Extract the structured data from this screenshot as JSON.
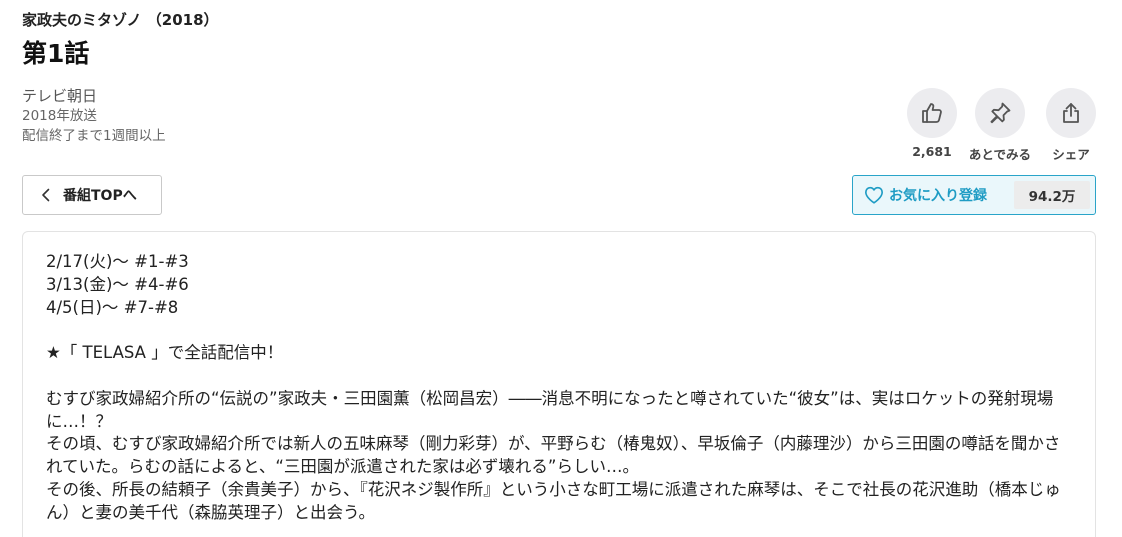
{
  "series_title": "家政夫のミタゾノ （2018）",
  "episode_title": "第1話",
  "meta": {
    "broadcaster": "テレビ朝日",
    "year": "2018年放送",
    "expiry": "配信終了まで1週間以上"
  },
  "actions": {
    "like": {
      "icon": "thumbs-up-icon",
      "label": "2,681"
    },
    "later": {
      "icon": "pin-icon",
      "label": "あとでみる"
    },
    "share": {
      "icon": "share-icon",
      "label": "シェア"
    }
  },
  "back_button": {
    "label": "番組TOPへ"
  },
  "favorite": {
    "label": "お気に入り登録",
    "count": "94.2万"
  },
  "colors": {
    "accent": "#1f9cc4",
    "accent_bg": "#eaf7fb",
    "circle_bg": "#ececef"
  },
  "description": {
    "schedule": [
      "2/17(火)～ #1-#3",
      "3/13(金)～ #4-#6",
      "4/5(日)～ #7-#8"
    ],
    "announcement": "★「 TELASA 」で全話配信中！",
    "paragraphs": [
      "むすび家政婦紹介所の“伝説の”家政夫・三田園薫（松岡昌宏）――消息不明になったと噂されていた“彼女”は、実はロケットの発射現場に…！？",
      "その頃、むすび家政婦紹介所では新人の五味麻琴（剛力彩芽）が、平野らむ（椿鬼奴）、早坂倫子（内藤理沙）から三田園の噂話を聞かされていた。らむの話によると、“三田園が派遣された家は必ず壊れる”らしい…。",
      "その後、所長の結頼子（余貴美子）から、『花沢ネジ製作所』という小さな町工場に派遣された麻琴は、そこで社長の花沢進助（橋本じゅん）と妻の美千代（森脇英理子）と出会う。"
    ]
  }
}
